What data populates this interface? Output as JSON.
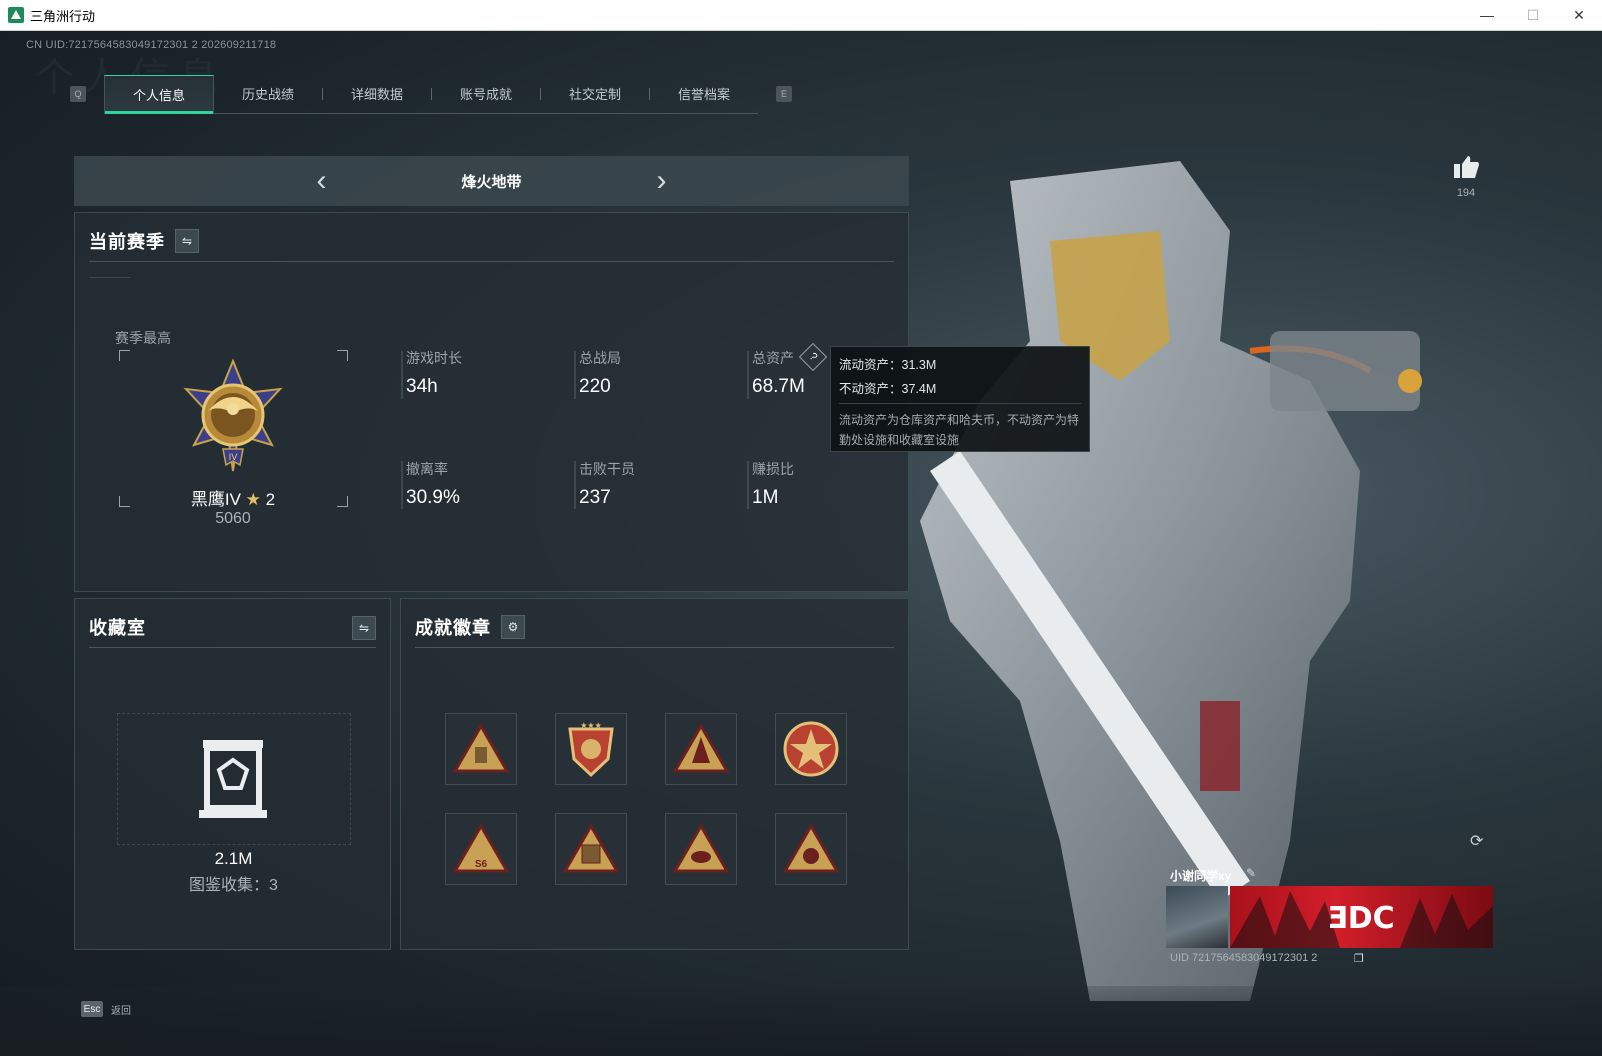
{
  "window": {
    "title": "三角洲行动",
    "controls": [
      "—",
      "☐",
      "✕"
    ]
  },
  "uid_line": "CN UID:7217564583049172301 2 202609211718",
  "watermark": "个人信息",
  "tabs": {
    "prev_key": "Q",
    "next_key": "E",
    "items": [
      "个人信息",
      "历史战绩",
      "详细数据",
      "账号成就",
      "社交定制",
      "信誉档案"
    ],
    "active": "个人信息"
  },
  "mode": {
    "title": "烽火地带",
    "prev": "‹",
    "next": "›"
  },
  "season": {
    "title": "当前赛季",
    "swap_icon": "swap-icon",
    "best_label": "赛季最高",
    "rank_name": "黑鹰IV",
    "rank_stars": "2",
    "rank_score": "5060",
    "stats": [
      {
        "label": "游戏时长",
        "value": "34h"
      },
      {
        "label": "总战局",
        "value": "220"
      },
      {
        "label": "总资产",
        "value": "68.7M"
      },
      {
        "label": "撤离率",
        "value": "30.9%"
      },
      {
        "label": "击败干员",
        "value": "237"
      },
      {
        "label": "赚损比",
        "value": "1M"
      }
    ],
    "help_icon": "?"
  },
  "tooltip": {
    "line1": "流动资产：31.3M",
    "line2": "不动资产：37.4M",
    "desc": "流动资产为仓库资产和哈夫币，不动资产为特勤处设施和收藏室设施"
  },
  "collection": {
    "title": "收藏室",
    "value": "2.1M",
    "count_label": "图鉴收集：3"
  },
  "badges": {
    "title": "成就徽章",
    "gear_icon": "gear-icon",
    "count": 8
  },
  "likes": {
    "count": "194"
  },
  "player_card": {
    "name": "小谢同学xy",
    "uid": "UID 7217564583049172301 2"
  },
  "footer": {
    "esc_key": "Esc",
    "back_label": "返回"
  },
  "colors": {
    "accent": "#2fd69b",
    "tooltip_bg": "#0e1214",
    "banner": "#d21e2a"
  }
}
